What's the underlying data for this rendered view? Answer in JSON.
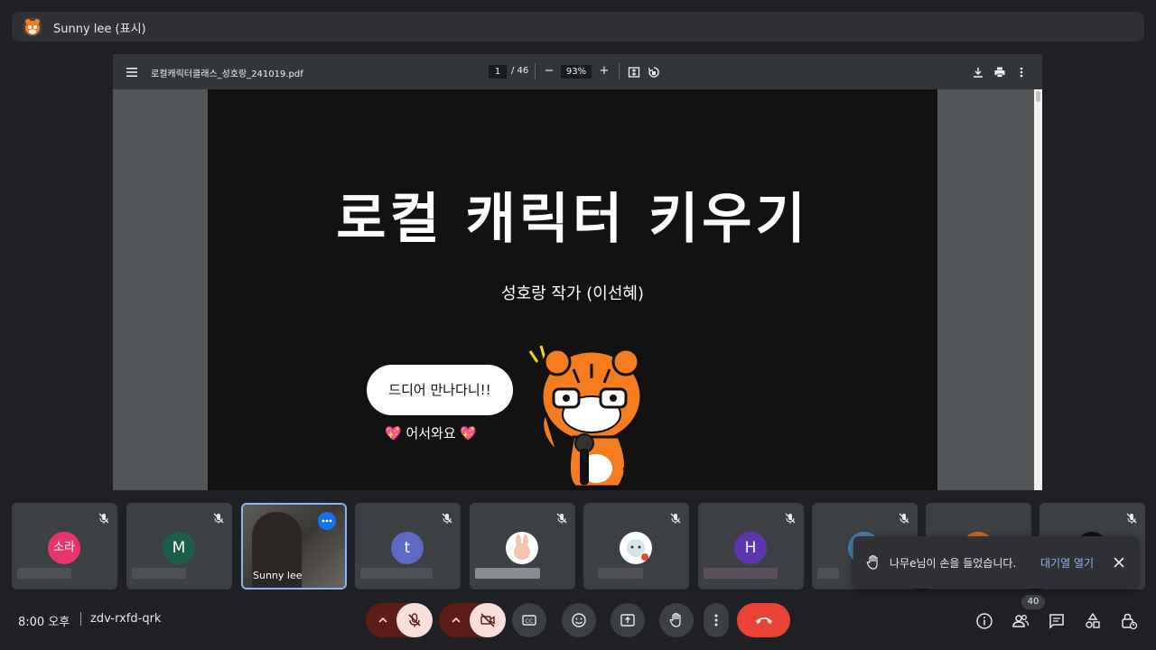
{
  "presenter": {
    "name": "Sunny lee (표시)"
  },
  "pdf": {
    "filename": "로컬캐릭터클래스_성호랑_241019.pdf",
    "page_current": "1",
    "page_total": "/ 46",
    "zoom": "93%",
    "zoom_out": "−",
    "zoom_in": "+"
  },
  "slide": {
    "title": "로컬 캐릭터 키우기",
    "subtitle": "성호랑 작가 (이선혜)",
    "bubble": "드디어 만나다니!!",
    "welcome": "💖 어서와요 💖"
  },
  "participants": [
    {
      "avatar": "소라",
      "color": "#e8336d",
      "name": ""
    },
    {
      "avatar": "M",
      "color": "#1a5e4a",
      "name": ""
    },
    {
      "avatar": "",
      "color": "#5d5b5b",
      "name": "Sunny lee"
    },
    {
      "avatar": "t",
      "color": "#5c6bc0",
      "name": ""
    },
    {
      "avatar": "",
      "color": "#ffffff",
      "name": ""
    },
    {
      "avatar": "",
      "color": "#ffffff",
      "name": ""
    },
    {
      "avatar": "H",
      "color": "#5e35b1",
      "name": ""
    },
    {
      "avatar": "",
      "color": "#4a7fa8",
      "name": ""
    },
    {
      "avatar": "",
      "color": "#d2691e",
      "name": ""
    },
    {
      "avatar": "",
      "color": "#111111",
      "name": ""
    }
  ],
  "notification": {
    "text": "나무e님이 손을 들었습니다.",
    "link": "대기열 열기"
  },
  "footer": {
    "time": "8:00 오후",
    "meeting_code": "zdv-rxfd-qrk",
    "participant_count": "40"
  },
  "colors": {
    "end_call": "#ea4335",
    "muted_bg": "#f9dedc",
    "muted_arrow_bg": "#5c1d17",
    "accent": "#8ab4f8"
  }
}
